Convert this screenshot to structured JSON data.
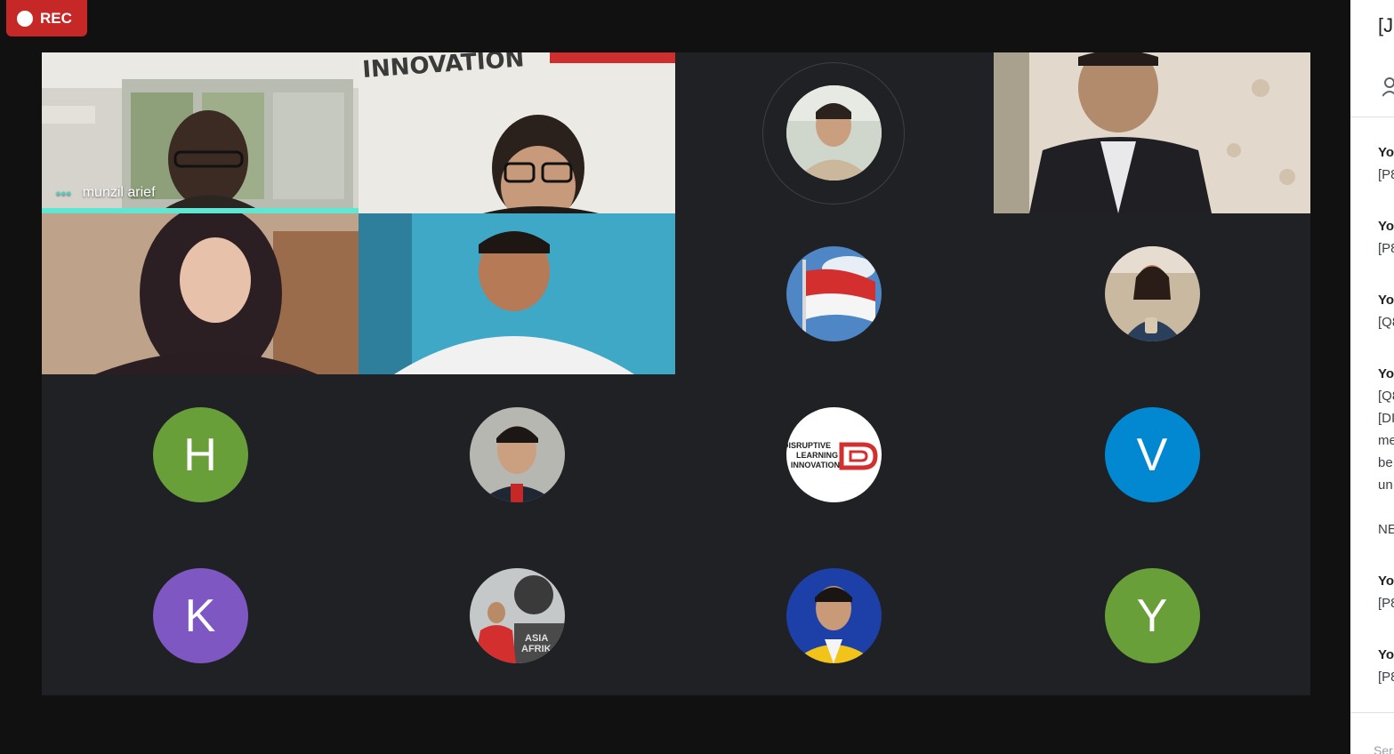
{
  "recording": {
    "label": "REC",
    "color": "#c62828"
  },
  "speaker": {
    "name": "munzil arief",
    "indicator": "•••"
  },
  "video_tiles": [
    {
      "id": "tile-speaker",
      "scene": "man with glasses by window",
      "bg": "#c9c6bf"
    },
    {
      "id": "tile-innovation",
      "scene": "man with glasses, INNOVATION sign",
      "sign_text": "INNOVATION",
      "bg": "#e8e6e1"
    },
    {
      "id": "tile-suit",
      "scene": "man in dark suit, floral wallpaper",
      "bg": "#d9cfc2"
    },
    {
      "id": "tile-hijab",
      "scene": "woman in hijab",
      "bg": "#b99a80"
    },
    {
      "id": "tile-blue",
      "scene": "man in white shirt, blue wall",
      "bg": "#3aa7c9"
    }
  ],
  "avatar_tiles": [
    {
      "kind": "photo",
      "icon": "man-in-jacket-photo",
      "ring": true
    },
    {
      "kind": "photo",
      "icon": "indonesia-flag-photo"
    },
    {
      "kind": "photo",
      "icon": "woman-holding-drink-photo"
    },
    {
      "kind": "letter",
      "letter": "H",
      "color": "#689f38"
    },
    {
      "kind": "photo",
      "icon": "young-man-portrait-photo"
    },
    {
      "kind": "logo",
      "icon": "disruptive-learning-logo",
      "logo_lines": [
        "DISRUPTIVE",
        "LEARNING",
        "INNOVATION"
      ]
    },
    {
      "kind": "letter",
      "letter": "V",
      "color": "#0288d1"
    },
    {
      "kind": "letter",
      "letter": "K",
      "color": "#7e57c2"
    },
    {
      "kind": "photo",
      "icon": "asia-afrika-monument-photo",
      "photo_text": [
        "ASIA",
        "AFRIK"
      ]
    },
    {
      "kind": "photo",
      "icon": "man-yellow-jacket-photo"
    },
    {
      "kind": "letter",
      "letter": "Y",
      "color": "#689f38"
    }
  ],
  "side_panel": {
    "title": "[J",
    "messages": [
      {
        "sender": "Yo",
        "lines": [
          "[P8"
        ]
      },
      {
        "sender": "Yo",
        "lines": [
          "[P8"
        ]
      },
      {
        "sender": "Yo",
        "lines": [
          "[Q8"
        ]
      },
      {
        "sender": "Yo",
        "lines": [
          "[Q8",
          "[DI",
          "me",
          "be",
          "un",
          "",
          "NE"
        ]
      },
      {
        "sender": "Yo",
        "lines": [
          "[P8"
        ]
      },
      {
        "sender": "Yo",
        "lines": [
          "[P8"
        ]
      }
    ],
    "input_placeholder": "Ser"
  }
}
